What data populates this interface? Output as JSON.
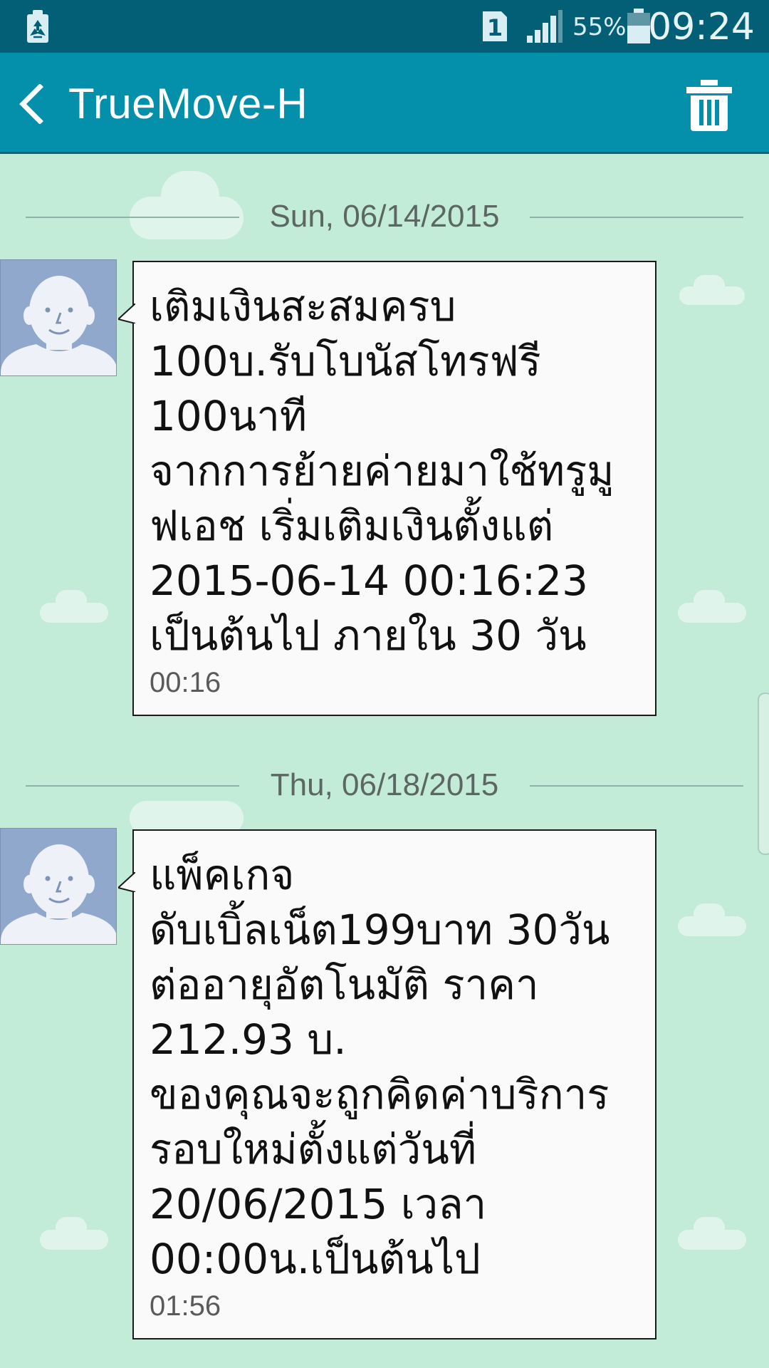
{
  "status_bar": {
    "sim_slot": "1",
    "battery_percent": "55%",
    "time": "09:24",
    "icons": [
      "recycle-icon",
      "sim-icon",
      "signal-icon",
      "battery-icon"
    ]
  },
  "header": {
    "title": "TrueMove-H",
    "back_icon": "chevron-left-icon",
    "delete_icon": "trash-icon"
  },
  "colors": {
    "status_bar": "#035f76",
    "action_bar": "#0490aa",
    "background": "#c2ecd8",
    "bubble": "#fafafa",
    "avatar": "#8fa8cc"
  },
  "messages": [
    {
      "date": "Sun, 06/14/2015",
      "text": "เติมเงินสะสมครบ\n100บ.รับโบนัสโทรฟรี\n100นาที\nจากการย้ายค่ายมาใช้ทรูมู\nฟเอช เริ่มเติมเงินตั้งแต่\n2015-06-14 00:16:23\nเป็นต้นไป ภายใน 30 วัน",
      "time": "00:16"
    },
    {
      "date": "Thu, 06/18/2015",
      "text": "แพ็คเกจ\nดับเบิ้ลเน็ต199บาท 30วัน\nต่ออายุอัตโนมัติ ราคา\n212.93 บ.\nของคุณจะถูกคิดค่าบริการ\nรอบใหม่ตั้งแต่วันที่\n20/06/2015 เวลา\n00:00น.เป็นต้นไป",
      "time": "01:56"
    }
  ]
}
